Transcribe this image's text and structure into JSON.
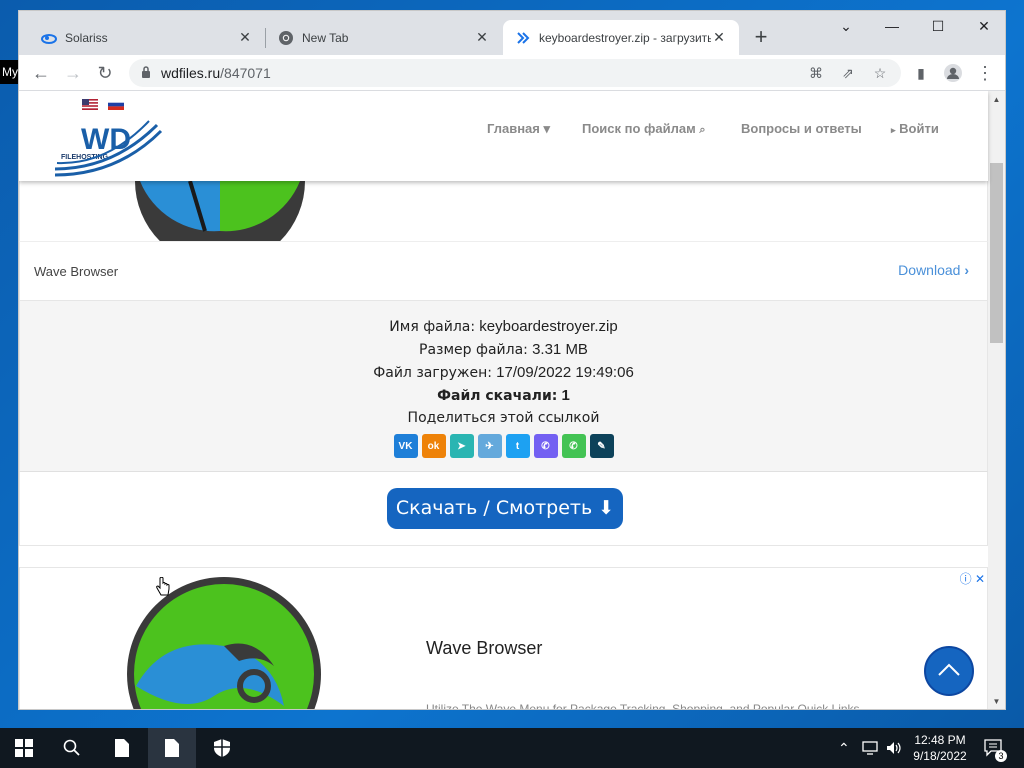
{
  "desktop": {
    "icon_label": "My"
  },
  "browser": {
    "tabs": [
      {
        "title": "Solariss",
        "icon": "solariss-logo-icon",
        "active": false
      },
      {
        "title": "New Tab",
        "icon": "chrome-icon",
        "active": false
      },
      {
        "title": "keyboardestroyer.zip - загрузить",
        "icon": "wdfiles-icon",
        "active": true
      }
    ],
    "url_host": "wdfiles.ru",
    "url_path": "/847071"
  },
  "site": {
    "nav": {
      "home": "Главная",
      "search": "Поиск по файлам",
      "faq": "Вопросы и ответы",
      "login": "Войти"
    },
    "logo_main": "WD",
    "logo_sub": "FILEHOSTING"
  },
  "ad_top": {
    "name": "Wave Browser",
    "download": "Download"
  },
  "file_info": {
    "name_label": "Имя файла:",
    "name_value": "keyboardestroyer.zip",
    "size_label": "Размер файла:",
    "size_value": "3.31 MB",
    "uploaded_label": "Файл загружен:",
    "uploaded_value": "17/09/2022 19:49:06",
    "downloads_label": "Файл скачали:",
    "downloads_value": "1",
    "share_label": "Поделиться этой ссылкой"
  },
  "share_buttons": [
    {
      "name": "vk",
      "color": "#1e7fd8",
      "glyph": "VK"
    },
    {
      "name": "odnoklassniki",
      "color": "#ee8208",
      "glyph": "ok"
    },
    {
      "name": "moimir",
      "color": "#2ab5b2",
      "glyph": "➤"
    },
    {
      "name": "telegram",
      "color": "#64a9dc",
      "glyph": "✈"
    },
    {
      "name": "twitter",
      "color": "#1da1f2",
      "glyph": "t"
    },
    {
      "name": "viber",
      "color": "#7360f2",
      "glyph": "✆"
    },
    {
      "name": "whatsapp",
      "color": "#43c354",
      "glyph": "✆"
    },
    {
      "name": "livejournal",
      "color": "#0d425a",
      "glyph": "✎"
    }
  ],
  "download_button": "Скачать / Смотреть",
  "ad_bottom": {
    "title": "Wave Browser",
    "desc": "Utilize The Wave Menu for Package Tracking, Shopping, and Popular Quick Links."
  },
  "taskbar": {
    "time": "12:48 PM",
    "date": "9/18/2022",
    "notifications": "3"
  }
}
